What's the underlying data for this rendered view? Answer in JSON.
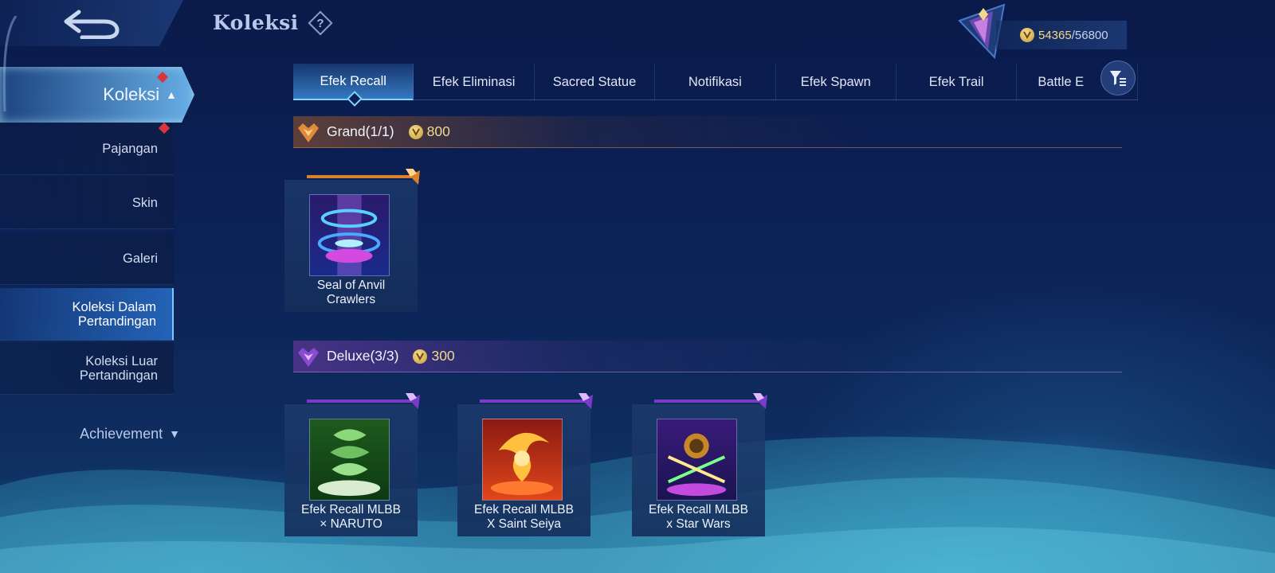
{
  "header": {
    "title": "Koleksi",
    "help_symbol": "?",
    "points": {
      "current": "54365",
      "separator": "/",
      "max": "56800"
    }
  },
  "sidebar": {
    "active_section": "Koleksi",
    "items": [
      {
        "label": "Pajangan"
      },
      {
        "label": "Skin"
      },
      {
        "label": "Galeri"
      },
      {
        "label": "Koleksi Dalam\nPertandingan"
      },
      {
        "label": "Koleksi Luar\nPertandingan"
      }
    ],
    "achievement": "Achievement"
  },
  "tabs": [
    {
      "label": "Efek Recall"
    },
    {
      "label": "Efek Eliminasi"
    },
    {
      "label": "Sacred Statue"
    },
    {
      "label": "Notifikasi"
    },
    {
      "label": "Efek Spawn"
    },
    {
      "label": "Efek Trail"
    },
    {
      "label": "Battle E"
    }
  ],
  "sections": {
    "grand": {
      "title": "Grand(1/1)",
      "cost": "800"
    },
    "deluxe": {
      "title": "Deluxe(3/3)",
      "cost": "300"
    }
  },
  "items": {
    "grand": [
      {
        "name": "Seal of Anvil\nCrawlers",
        "icon": "anvil-seal-icon"
      }
    ],
    "deluxe": [
      {
        "name": "Efek Recall MLBB\n× NARUTO",
        "icon": "naruto-recall-icon"
      },
      {
        "name": "Efek Recall MLBB\nX Saint Seiya",
        "icon": "saint-seiya-recall-icon"
      },
      {
        "name": "Efek Recall MLBB\nx Star Wars",
        "icon": "star-wars-recall-icon"
      }
    ]
  },
  "colors": {
    "accent": "#7fd6ff",
    "gold": "#f3d88a",
    "grand_tier": "#e08a3a",
    "deluxe_tier": "#9a5ad8",
    "notification": "#d8353c"
  }
}
